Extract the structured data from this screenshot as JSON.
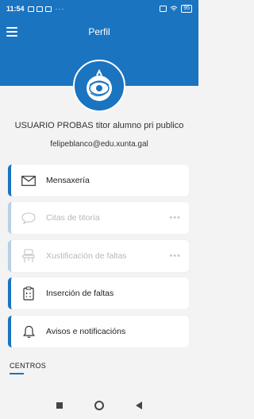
{
  "status_bar": {
    "time": "11:54",
    "dots": "···",
    "battery": "95"
  },
  "header": {
    "title": "Perfil"
  },
  "profile": {
    "name": "USUARIO PROBAS titor alumno pri publico",
    "email": "felipeblanco@edu.xunta.gal"
  },
  "menu": [
    {
      "label": "Mensaxería",
      "icon": "mail-icon",
      "disabled": false
    },
    {
      "label": "Citas de titoría",
      "icon": "chat-bubble-icon",
      "disabled": true,
      "more": "•••"
    },
    {
      "label": "Xustificación de faltas",
      "icon": "desk-chair-icon",
      "disabled": true,
      "more": "•••"
    },
    {
      "label": "Inserción de faltas",
      "icon": "clipboard-icon",
      "disabled": false
    },
    {
      "label": "Avisos e notificacións",
      "icon": "bell-icon",
      "disabled": false
    }
  ],
  "section": {
    "title": "CENTROS"
  },
  "colors": {
    "primary": "#1a74c0",
    "disabled_border": "#b9cfe5"
  }
}
